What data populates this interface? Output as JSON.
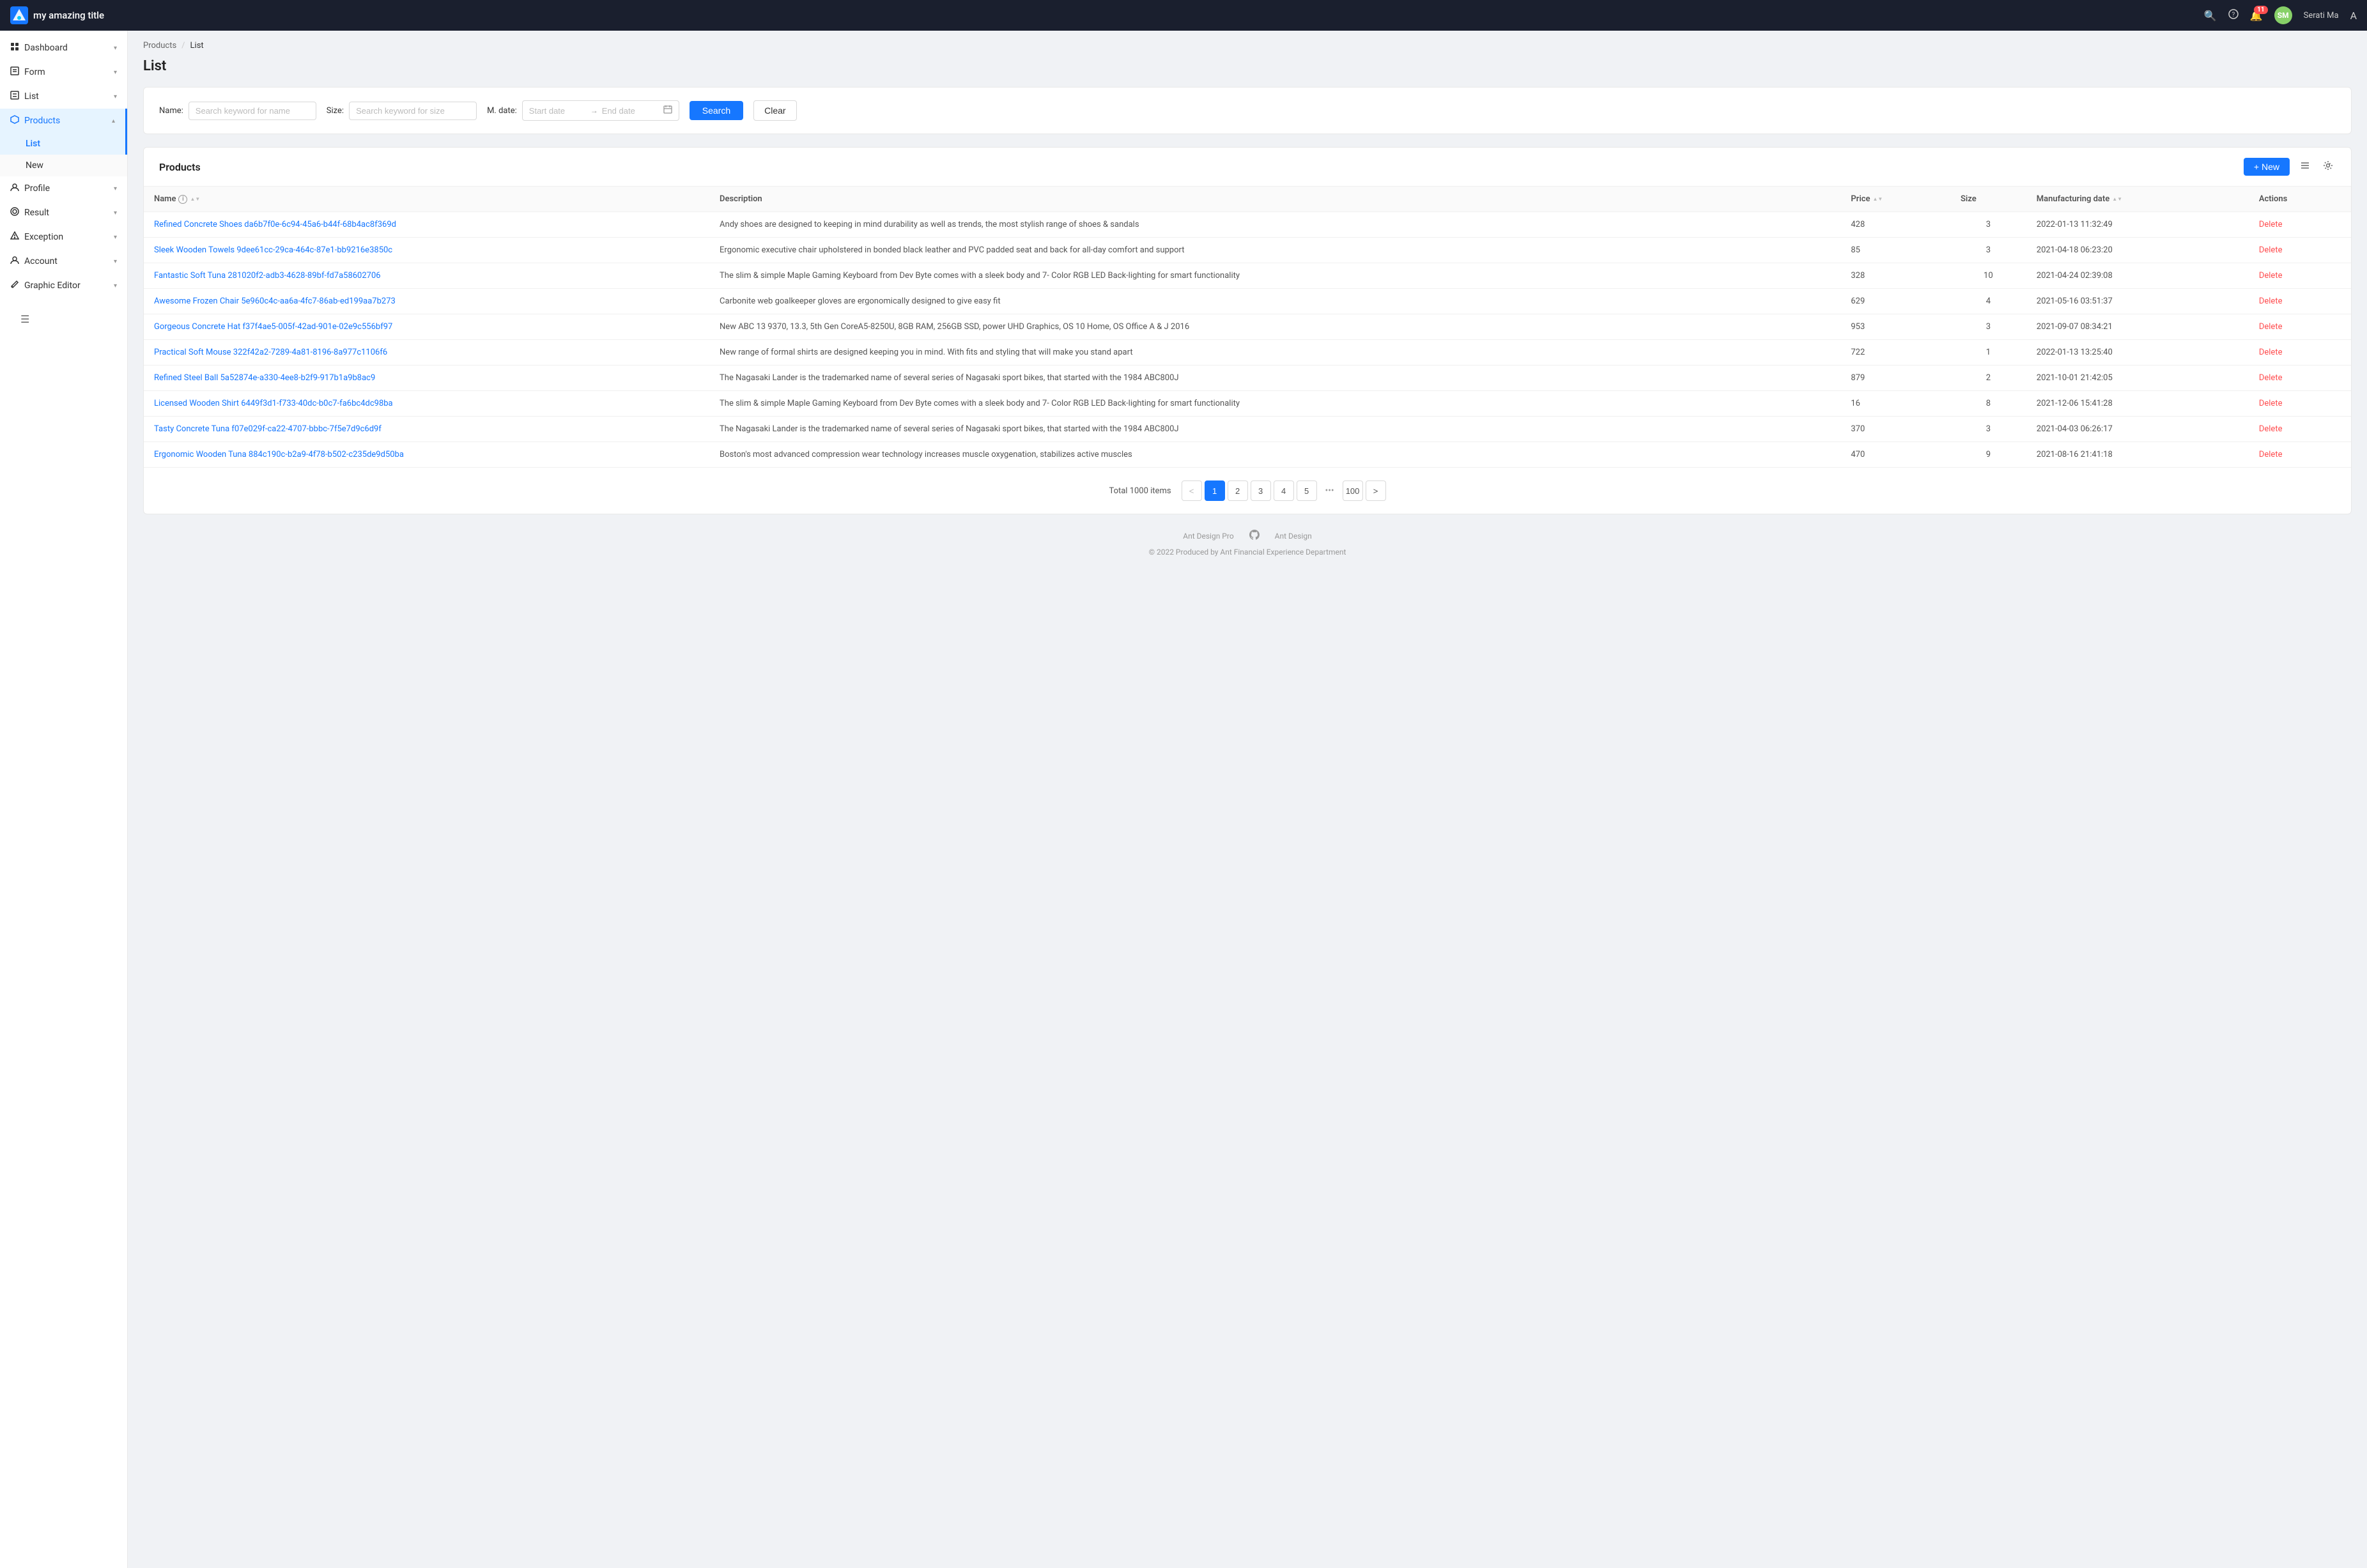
{
  "app": {
    "title": "my amazing title",
    "logo_alt": "logo"
  },
  "topnav": {
    "search_icon": "🔍",
    "help_icon": "?",
    "notif_icon": "🔔",
    "notif_count": "11",
    "user_initials": "SM",
    "user_name": "Serati Ma",
    "lang_icon": "A"
  },
  "sidebar": {
    "menu_icon": "☰",
    "items": [
      {
        "id": "dashboard",
        "label": "Dashboard",
        "icon": "⊞",
        "has_arrow": true,
        "active": false
      },
      {
        "id": "form",
        "label": "Form",
        "icon": "✏",
        "has_arrow": true,
        "active": false
      },
      {
        "id": "list",
        "label": "List",
        "icon": "▦",
        "has_arrow": true,
        "active": false
      },
      {
        "id": "products",
        "label": "Products",
        "icon": "✔",
        "has_arrow": true,
        "active": true,
        "children": [
          {
            "id": "products-list",
            "label": "List",
            "active": true
          },
          {
            "id": "products-new",
            "label": "New",
            "active": false
          }
        ]
      },
      {
        "id": "profile",
        "label": "Profile",
        "icon": "👤",
        "has_arrow": true,
        "active": false
      },
      {
        "id": "result",
        "label": "Result",
        "icon": "◎",
        "has_arrow": true,
        "active": false
      },
      {
        "id": "exception",
        "label": "Exception",
        "icon": "⚠",
        "has_arrow": true,
        "active": false
      },
      {
        "id": "account",
        "label": "Account",
        "icon": "👤",
        "has_arrow": true,
        "active": false
      },
      {
        "id": "graphic-editor",
        "label": "Graphic Editor",
        "icon": "✏",
        "has_arrow": true,
        "active": false
      }
    ]
  },
  "breadcrumb": {
    "items": [
      "Products",
      "List"
    ]
  },
  "page": {
    "title": "List"
  },
  "filter": {
    "name_label": "Name:",
    "name_placeholder": "Search keyword for name",
    "size_label": "Size:",
    "size_placeholder": "Search keyword for size",
    "date_label": "M. date:",
    "start_placeholder": "Start date",
    "end_placeholder": "End date",
    "search_btn": "Search",
    "clear_btn": "Clear"
  },
  "products": {
    "title": "Products",
    "new_btn": "+ New",
    "columns": [
      "Name",
      "Description",
      "Price",
      "Size",
      "Manufacturing date",
      "Actions"
    ],
    "rows": [
      {
        "name": "Refined Concrete Shoes da6b7f0e-6c94-45a6-b44f-68b4ac8f369d",
        "description": "Andy shoes are designed to keeping in mind durability as well as trends, the most stylish range of shoes & sandals",
        "price": "428",
        "size": "3",
        "date": "2022-01-13 11:32:49",
        "action": "Delete"
      },
      {
        "name": "Sleek Wooden Towels 9dee61cc-29ca-464c-87e1-bb9216e3850c",
        "description": "Ergonomic executive chair upholstered in bonded black leather and PVC padded seat and back for all-day comfort and support",
        "price": "85",
        "size": "3",
        "date": "2021-04-18 06:23:20",
        "action": "Delete"
      },
      {
        "name": "Fantastic Soft Tuna 281020f2-adb3-4628-89bf-fd7a58602706",
        "description": "The slim & simple Maple Gaming Keyboard from Dev Byte comes with a sleek body and 7- Color RGB LED Back-lighting for smart functionality",
        "price": "328",
        "size": "10",
        "date": "2021-04-24 02:39:08",
        "action": "Delete"
      },
      {
        "name": "Awesome Frozen Chair 5e960c4c-aa6a-4fc7-86ab-ed199aa7b273",
        "description": "Carbonite web goalkeeper gloves are ergonomically designed to give easy fit",
        "price": "629",
        "size": "4",
        "date": "2021-05-16 03:51:37",
        "action": "Delete"
      },
      {
        "name": "Gorgeous Concrete Hat f37f4ae5-005f-42ad-901e-02e9c556bf97",
        "description": "New ABC 13 9370, 13.3, 5th Gen CoreA5-8250U, 8GB RAM, 256GB SSD, power UHD Graphics, OS 10 Home, OS Office A & J 2016",
        "price": "953",
        "size": "3",
        "date": "2021-09-07 08:34:21",
        "action": "Delete"
      },
      {
        "name": "Practical Soft Mouse 322f42a2-7289-4a81-8196-8a977c1106f6",
        "description": "New range of formal shirts are designed keeping you in mind. With fits and styling that will make you stand apart",
        "price": "722",
        "size": "1",
        "date": "2022-01-13 13:25:40",
        "action": "Delete"
      },
      {
        "name": "Refined Steel Ball 5a52874e-a330-4ee8-b2f9-917b1a9b8ac9",
        "description": "The Nagasaki Lander is the trademarked name of several series of Nagasaki sport bikes, that started with the 1984 ABC800J",
        "price": "879",
        "size": "2",
        "date": "2021-10-01 21:42:05",
        "action": "Delete"
      },
      {
        "name": "Licensed Wooden Shirt 6449f3d1-f733-40dc-b0c7-fa6bc4dc98ba",
        "description": "The slim & simple Maple Gaming Keyboard from Dev Byte comes with a sleek body and 7- Color RGB LED Back-lighting for smart functionality",
        "price": "16",
        "size": "8",
        "date": "2021-12-06 15:41:28",
        "action": "Delete"
      },
      {
        "name": "Tasty Concrete Tuna f07e029f-ca22-4707-bbbc-7f5e7d9c6d9f",
        "description": "The Nagasaki Lander is the trademarked name of several series of Nagasaki sport bikes, that started with the 1984 ABC800J",
        "price": "370",
        "size": "3",
        "date": "2021-04-03 06:26:17",
        "action": "Delete"
      },
      {
        "name": "Ergonomic Wooden Tuna 884c190c-b2a9-4f78-b502-c235de9d50ba",
        "description": "Boston's most advanced compression wear technology increases muscle oxygenation, stabilizes active muscles",
        "price": "470",
        "size": "9",
        "date": "2021-08-16 21:41:18",
        "action": "Delete"
      }
    ]
  },
  "pagination": {
    "total_text": "Total 1000 items",
    "pages": [
      "1",
      "2",
      "3",
      "4",
      "5"
    ],
    "ellipsis": "•••",
    "last_page": "100",
    "prev_icon": "<",
    "next_icon": ">"
  },
  "footer": {
    "link1": "Ant Design Pro",
    "link2": "Ant Design",
    "copyright": "© 2022 Produced by Ant Financial Experience Department"
  }
}
